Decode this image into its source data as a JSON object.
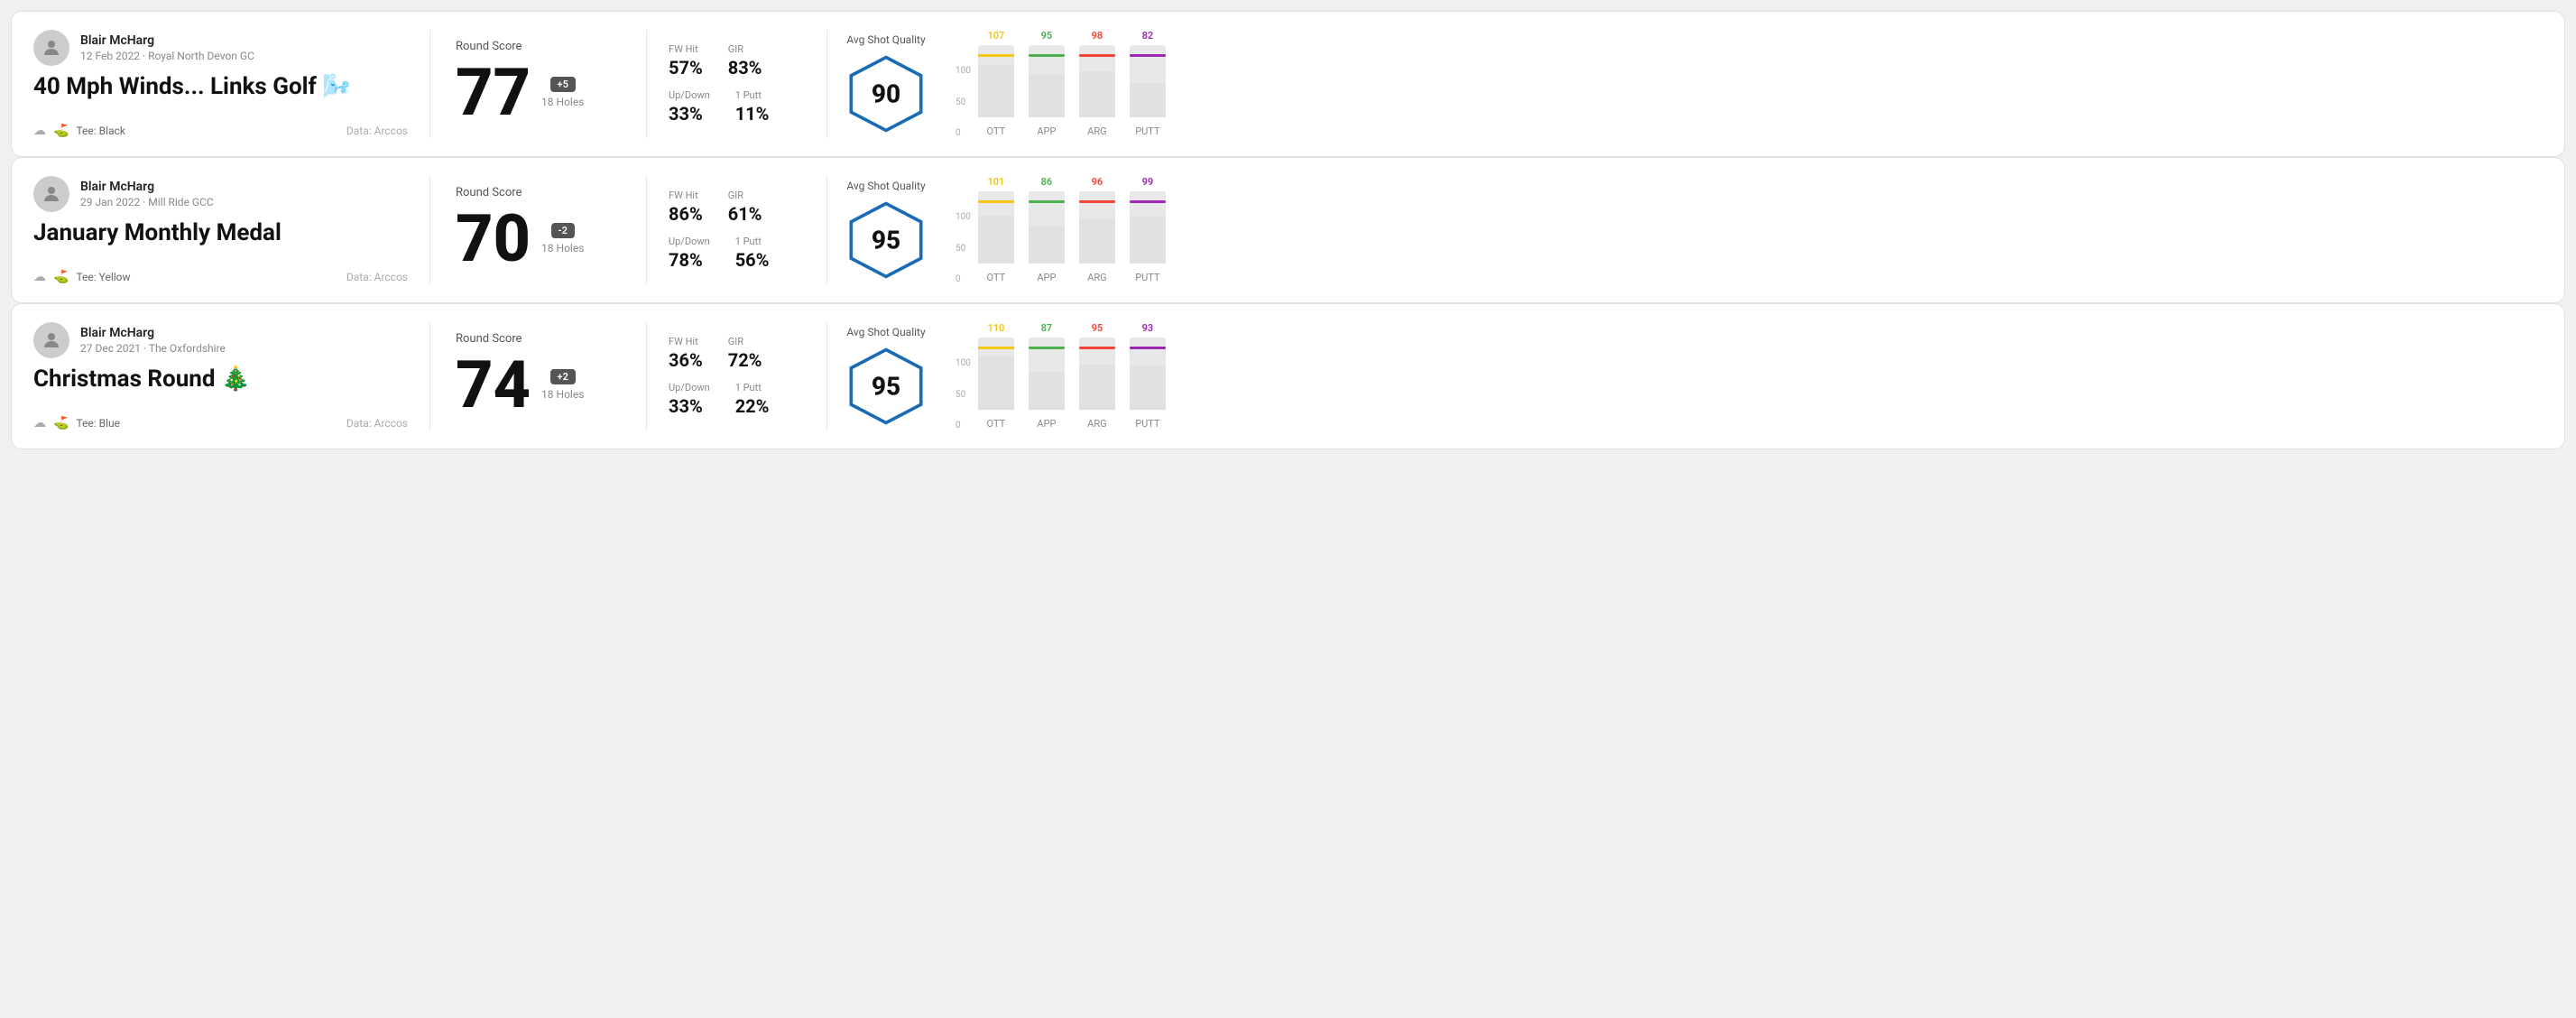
{
  "rounds": [
    {
      "id": "round1",
      "user": {
        "name": "Blair McHarg",
        "date_course": "12 Feb 2022 · Royal North Devon GC"
      },
      "title": "40 Mph Winds... Links Golf 🌬️",
      "tee": "Black",
      "data_source": "Data: Arccos",
      "round_score_label": "Round Score",
      "score": "77",
      "badge": "+5",
      "holes": "18 Holes",
      "fw_hit_label": "FW Hit",
      "fw_hit": "57%",
      "gir_label": "GIR",
      "gir": "83%",
      "updown_label": "Up/Down",
      "updown": "33%",
      "oneputt_label": "1 Putt",
      "oneputt": "11%",
      "avg_shot_label": "Avg Shot Quality",
      "hex_score": "90",
      "bars": [
        {
          "label": "OTT",
          "value": 107,
          "color": "#f5c518",
          "height_pct": 72
        },
        {
          "label": "APP",
          "value": 95,
          "color": "#4caf50",
          "height_pct": 60
        },
        {
          "label": "ARG",
          "value": 98,
          "color": "#f44336",
          "height_pct": 64
        },
        {
          "label": "PUTT",
          "value": 82,
          "color": "#9c27b0",
          "height_pct": 48
        }
      ]
    },
    {
      "id": "round2",
      "user": {
        "name": "Blair McHarg",
        "date_course": "29 Jan 2022 · Mill Ride GCC"
      },
      "title": "January Monthly Medal",
      "tee": "Yellow",
      "data_source": "Data: Arccos",
      "round_score_label": "Round Score",
      "score": "70",
      "badge": "-2",
      "holes": "18 Holes",
      "fw_hit_label": "FW Hit",
      "fw_hit": "86%",
      "gir_label": "GIR",
      "gir": "61%",
      "updown_label": "Up/Down",
      "updown": "78%",
      "oneputt_label": "1 Putt",
      "oneputt": "56%",
      "avg_shot_label": "Avg Shot Quality",
      "hex_score": "95",
      "bars": [
        {
          "label": "OTT",
          "value": 101,
          "color": "#f5c518",
          "height_pct": 66
        },
        {
          "label": "APP",
          "value": 86,
          "color": "#4caf50",
          "height_pct": 52
        },
        {
          "label": "ARG",
          "value": 96,
          "color": "#f44336",
          "height_pct": 63
        },
        {
          "label": "PUTT",
          "value": 99,
          "color": "#9c27b0",
          "height_pct": 65
        }
      ]
    },
    {
      "id": "round3",
      "user": {
        "name": "Blair McHarg",
        "date_course": "27 Dec 2021 · The Oxfordshire"
      },
      "title": "Christmas Round 🎄",
      "tee": "Blue",
      "data_source": "Data: Arccos",
      "round_score_label": "Round Score",
      "score": "74",
      "badge": "+2",
      "holes": "18 Holes",
      "fw_hit_label": "FW Hit",
      "fw_hit": "36%",
      "gir_label": "GIR",
      "gir": "72%",
      "updown_label": "Up/Down",
      "updown": "33%",
      "oneputt_label": "1 Putt",
      "oneputt": "22%",
      "avg_shot_label": "Avg Shot Quality",
      "hex_score": "95",
      "bars": [
        {
          "label": "OTT",
          "value": 110,
          "color": "#f5c518",
          "height_pct": 74
        },
        {
          "label": "APP",
          "value": 87,
          "color": "#4caf50",
          "height_pct": 53
        },
        {
          "label": "ARG",
          "value": 95,
          "color": "#f44336",
          "height_pct": 62
        },
        {
          "label": "PUTT",
          "value": 93,
          "color": "#9c27b0",
          "height_pct": 60
        }
      ]
    }
  ],
  "y_axis_labels": [
    "100",
    "50",
    "0"
  ]
}
